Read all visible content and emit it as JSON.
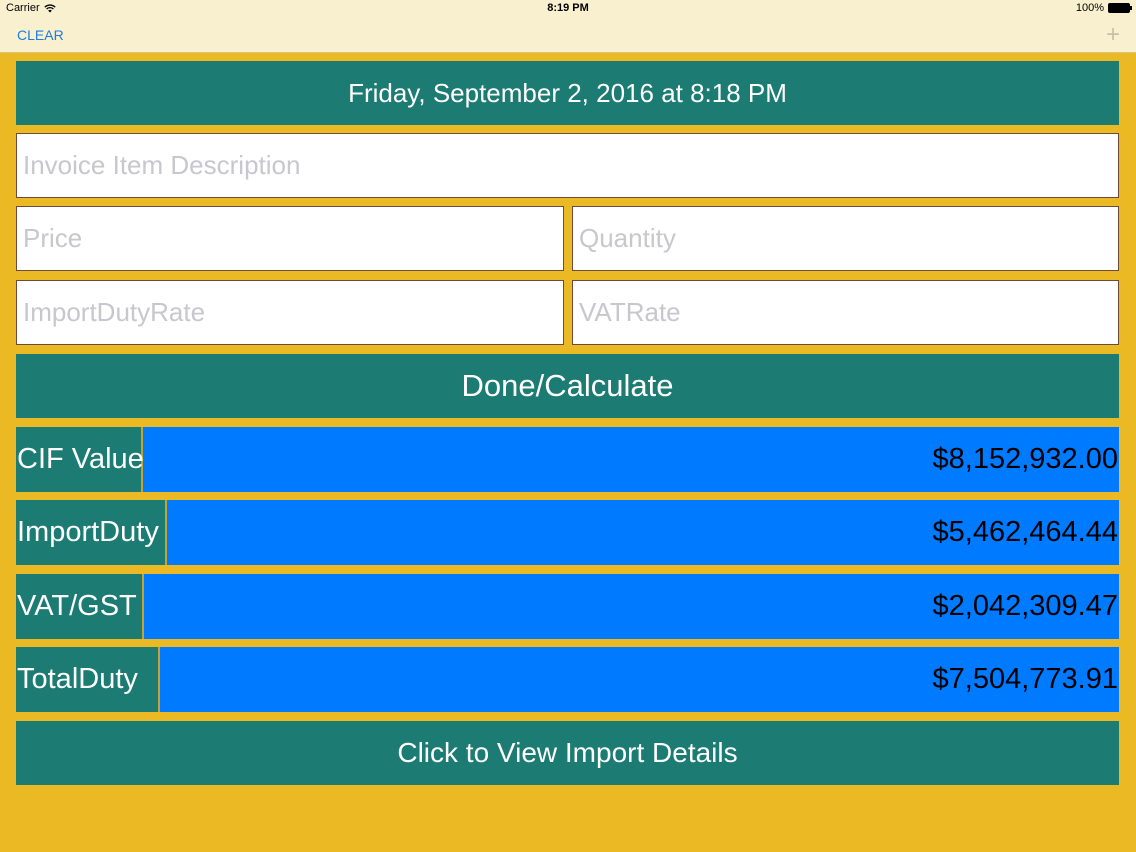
{
  "status_bar": {
    "carrier": "Carrier",
    "time": "8:19 PM",
    "battery": "100%"
  },
  "nav": {
    "clear_label": "CLEAR",
    "add_icon": "plus-icon"
  },
  "date_label": "Friday, September 2, 2016 at 8:18 PM",
  "form": {
    "description_placeholder": "Invoice Item Description",
    "price_placeholder": "Price",
    "quantity_placeholder": "Quantity",
    "import_duty_rate_placeholder": "ImportDutyRate",
    "vat_rate_placeholder": "VATRate"
  },
  "done_button_label": "Done/Calculate",
  "results": [
    {
      "label": "CIF Value",
      "value": "$8,152,932.00"
    },
    {
      "label": "ImportDuty",
      "value": "$5,462,464.44"
    },
    {
      "label": "VAT/GST",
      "value": "$2,042,309.47"
    },
    {
      "label": "TotalDuty",
      "value": "$7,504,773.91"
    }
  ],
  "view_details_label": "Click to View Import Details",
  "colors": {
    "background": "#EBB923",
    "teal": "#1C7B72",
    "value_blue": "#007AFF",
    "nav_bg": "#F9F0CF",
    "link_blue": "#1F7CE0"
  }
}
